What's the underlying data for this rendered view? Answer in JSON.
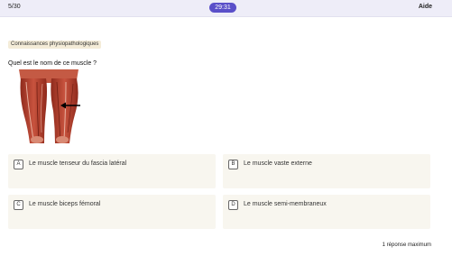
{
  "header": {
    "progress": "5/30",
    "timer": "29:31",
    "help_label": "Aide"
  },
  "question": {
    "category": "Connaissances physiopathologiques",
    "prompt": "Quel est le nom de ce muscle ?",
    "image_icon": "leg-muscle-anatomy-illustration"
  },
  "options": [
    {
      "letter": "A",
      "label": "Le muscle tenseur du fascia latéral"
    },
    {
      "letter": "B",
      "label": "Le muscle vaste externe"
    },
    {
      "letter": "C",
      "label": "Le muscle biceps fémoral"
    },
    {
      "letter": "D",
      "label": "Le muscle semi-membraneux"
    }
  ],
  "footer": {
    "note": "1 réponse maximum"
  },
  "colors": {
    "topbar": "#eeedf8",
    "timer_badge": "#5a4fc9",
    "category_chip": "#f4ecd8",
    "option_card": "#f8f6ef",
    "muscle_red": "#b23a2a"
  }
}
